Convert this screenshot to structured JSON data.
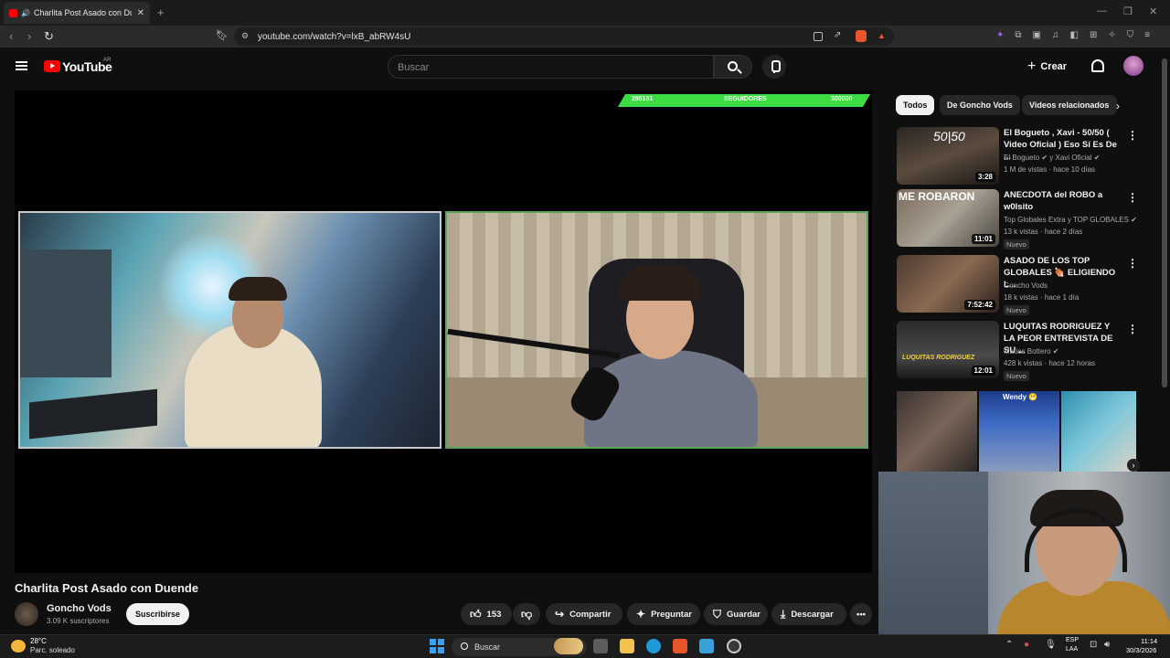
{
  "browser": {
    "tab_title": "Charlita Post Asado con Duende",
    "new_tab": "+",
    "url": "youtube.com/watch?v=lxB_abRW4sU"
  },
  "youtube": {
    "logo_text": "YouTube",
    "country_code": "AR",
    "search_placeholder": "Buscar",
    "create_label": "Crear"
  },
  "overlay": {
    "current": "295151",
    "label": "SEGUIDORES",
    "goal": "300000",
    "progress_fraction": 0.984
  },
  "video": {
    "title": "Charlita Post Asado con Duende",
    "channel": "Goncho Vods",
    "subscribers": "3.09 K suscriptores",
    "subscribe_label": "Suscribirse",
    "likes": "153",
    "share_label": "Compartir",
    "ask_label": "Preguntar",
    "save_label": "Guardar",
    "download_label": "Descargar"
  },
  "sidebar": {
    "chips": [
      "Todos",
      "De Goncho Vods",
      "Videos relacionados"
    ],
    "recommendations": [
      {
        "title": "El Bogueto , Xavi - 50/50 ( Video Oficial ) Eso Sí Es De ...",
        "channel": "El Bogueto ✔ y Xavi Oficial ✔",
        "meta": "1 M de vistas · hace 10 días",
        "duration": "3:28",
        "thumb_text": "50|50",
        "badge": ""
      },
      {
        "title": "ANECDOTA del ROBO a w0lsito",
        "channel": "Top Globales Extra y TOP GLOBALES ✔",
        "meta": "13 k vistas · hace 2 días",
        "duration": "11:01",
        "thumb_text": "ME ROBARON",
        "badge": "Nuevo"
      },
      {
        "title": "ASADO DE LOS TOP GLOBALES 🍖 ELIGIENDO L...",
        "channel": "Goncho Vods",
        "meta": "18 k vistas · hace 1 día",
        "duration": "7:52:42",
        "thumb_text": "",
        "badge": "Nuevo"
      },
      {
        "title": "LUQUITAS RODRIGUEZ Y LA PEOR ENTREVISTA DE SU ...",
        "channel": "Matias Bottero ✔",
        "meta": "428 k vistas · hace 12 horas",
        "duration": "12:01",
        "thumb_text": "LUQUITAS RODRIGUEZ",
        "badge": "Nuevo"
      }
    ],
    "shorts_label": "Wendy 😬"
  },
  "taskbar": {
    "temperature": "28°C",
    "weather": "Parc. soleado",
    "search": "Buscar",
    "lang1": "ESP",
    "lang2": "LAA",
    "time": "11:14",
    "date": "30/3/2026"
  },
  "colors": {
    "youtube_red": "#ff0000",
    "follow_bar": "#3ddc43",
    "background": "#0f0f0f"
  }
}
